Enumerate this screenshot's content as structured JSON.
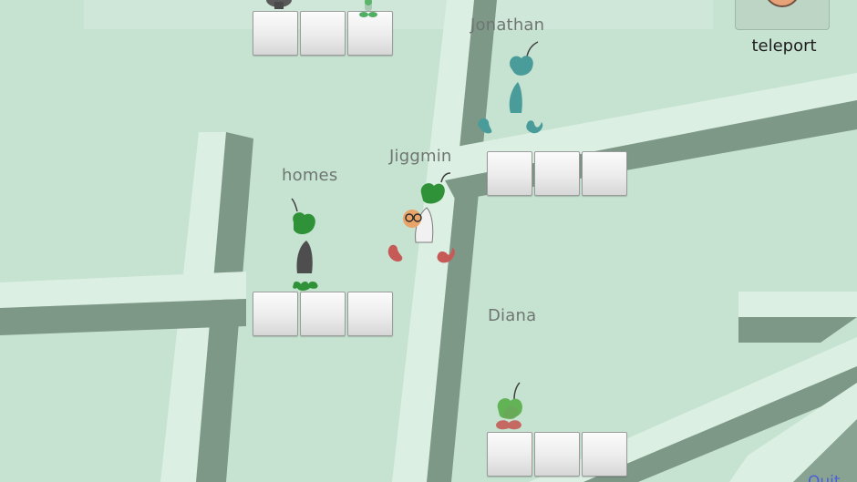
{
  "scene": {
    "background_color": "#c6e2d0",
    "road_light_color": "#dcefe3",
    "road_shadow_color": "#7e9888"
  },
  "players": [
    {
      "id": "jonathan",
      "name": "Jonathan",
      "body_color": "#4a9c9a",
      "head_color": "#3e8f8d"
    },
    {
      "id": "jiggmin",
      "name": "Jiggmin",
      "body_color": "#f1f1f1",
      "head_color": "#2f9138",
      "feet_color": "#c55a57",
      "accessory": "orange-face-with-glasses"
    },
    {
      "id": "homes",
      "name": "homes",
      "body_color": "#4e4e4e",
      "head_color": "#2f9138",
      "feet_color": "#2f9138"
    },
    {
      "id": "diana",
      "name": "Diana",
      "body_color": "#6aa85a",
      "head_color": "#62b356",
      "feet_color": "#c56a62"
    }
  ],
  "controls": {
    "teleport_label": "teleport",
    "teleport_icon": "orange-circle-icon",
    "quit_label": "Quit"
  },
  "blocks": {
    "color": "#efefef",
    "border_color": "#9b9b9b"
  }
}
